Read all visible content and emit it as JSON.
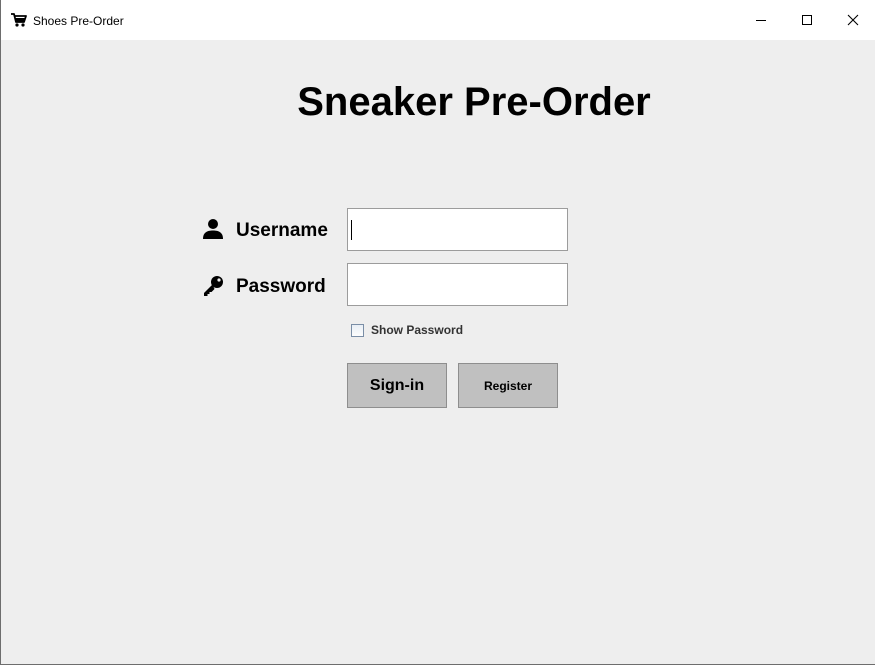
{
  "window": {
    "title": "Shoes Pre-Order",
    "icon": "shopping-cart-icon",
    "controls": {
      "minimize": "minimize-icon",
      "maximize": "maximize-icon",
      "close": "close-icon"
    }
  },
  "login": {
    "heading": "Sneaker Pre-Order",
    "username": {
      "label": "Username",
      "icon": "user-icon",
      "value": "",
      "focused": true
    },
    "password": {
      "label": "Password",
      "icon": "key-icon",
      "value": ""
    },
    "show_password": {
      "label": "Show Password",
      "checked": false
    },
    "buttons": {
      "signin_label": "Sign-in",
      "register_label": "Register"
    }
  },
  "colors": {
    "background": "#eeeeee",
    "titlebar": "#ffffff",
    "button_face": "#c0c0c0",
    "text": "#000000"
  }
}
